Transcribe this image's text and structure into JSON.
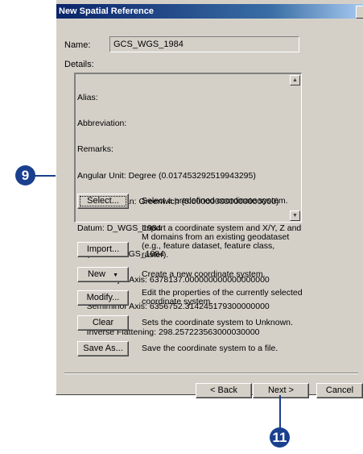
{
  "window": {
    "title": "New Spatial Reference"
  },
  "name_label": "Name:",
  "name_value": "GCS_WGS_1984",
  "details_label": "Details:",
  "details_lines": [
    "Alias:",
    "Abbreviation:",
    "Remarks:",
    "Angular Unit: Degree (0.017453292519943295)",
    "Prime Meridian: Greenwich (0.000000000000000000)",
    "Datum: D_WGS_1984",
    "  Spheroid: WGS_1984",
    "    Semimajor Axis: 6378137.000000000000000000",
    "    Semiminor Axis: 6356752.314245179300000000",
    "    Inverse Flattening: 298.257223563000030000"
  ],
  "actions": [
    {
      "label": "Select...",
      "description": "Select a predefined coordinate system."
    },
    {
      "label": "Import...",
      "description": "Import a coordinate system and X/Y, Z and M domains from an existing geodataset (e.g., feature dataset, feature class, raster)."
    },
    {
      "label": "New",
      "description": "Create a new coordinate system."
    },
    {
      "label": "Modify...",
      "description": "Edit the properties of the currently selected coordinate system."
    },
    {
      "label": "Clear",
      "description": "Sets the coordinate system to Unknown."
    },
    {
      "label": "Save As...",
      "description": "Save the coordinate system to a file."
    }
  ],
  "footer": {
    "back_label": "< Back",
    "next_label": "Next >",
    "cancel_label": "Cancel"
  },
  "callouts": {
    "details": "9",
    "next": "11"
  },
  "colors": {
    "callout": "#1a3f8f",
    "dialog_bg": "#d4d0c8",
    "title_start": "#0a246a"
  }
}
